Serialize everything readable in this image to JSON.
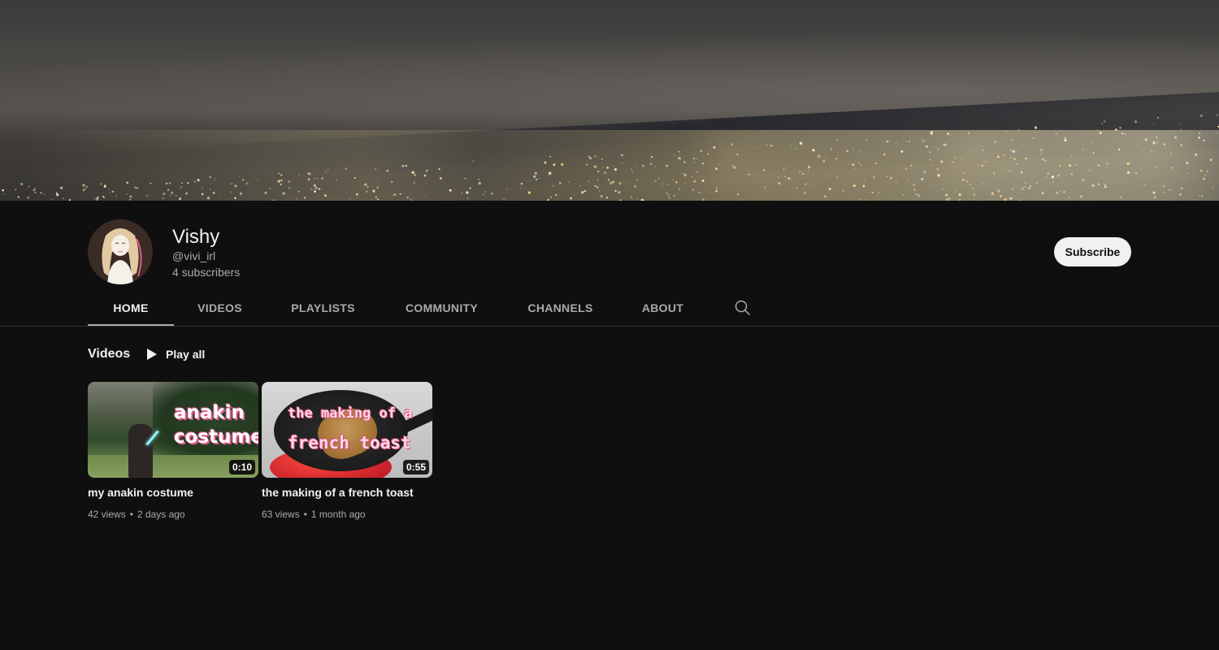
{
  "channel": {
    "name": "Vishy",
    "handle": "@vivi_irl",
    "subscribers": "4 subscribers",
    "subscribe_label": "Subscribe"
  },
  "tabs": [
    {
      "label": "HOME",
      "active": true
    },
    {
      "label": "VIDEOS",
      "active": false
    },
    {
      "label": "PLAYLISTS",
      "active": false
    },
    {
      "label": "COMMUNITY",
      "active": false
    },
    {
      "label": "CHANNELS",
      "active": false
    },
    {
      "label": "ABOUT",
      "active": false
    }
  ],
  "tab_search_icon": "search-icon",
  "section": {
    "title": "Videos",
    "play_all_label": "Play all",
    "play_icon": "play-icon"
  },
  "videos": [
    {
      "title": "my anakin costume",
      "views": "42 views",
      "age": "2 days ago",
      "duration": "0:10",
      "thumb_text_line1": "anakin",
      "thumb_text_line2": "costume"
    },
    {
      "title": "the making of a french toast",
      "views": "63 views",
      "age": "1 month ago",
      "duration": "0:55",
      "thumb_text_line1": "the making of a",
      "thumb_text_line2": "french toast"
    }
  ],
  "meta_separator": "•",
  "colors": {
    "background": "#0f0f0f",
    "text_primary": "#f1f1f1",
    "text_secondary": "#aaaaaa",
    "subscribe_bg": "#f1f1f1",
    "divider": "#303030"
  }
}
